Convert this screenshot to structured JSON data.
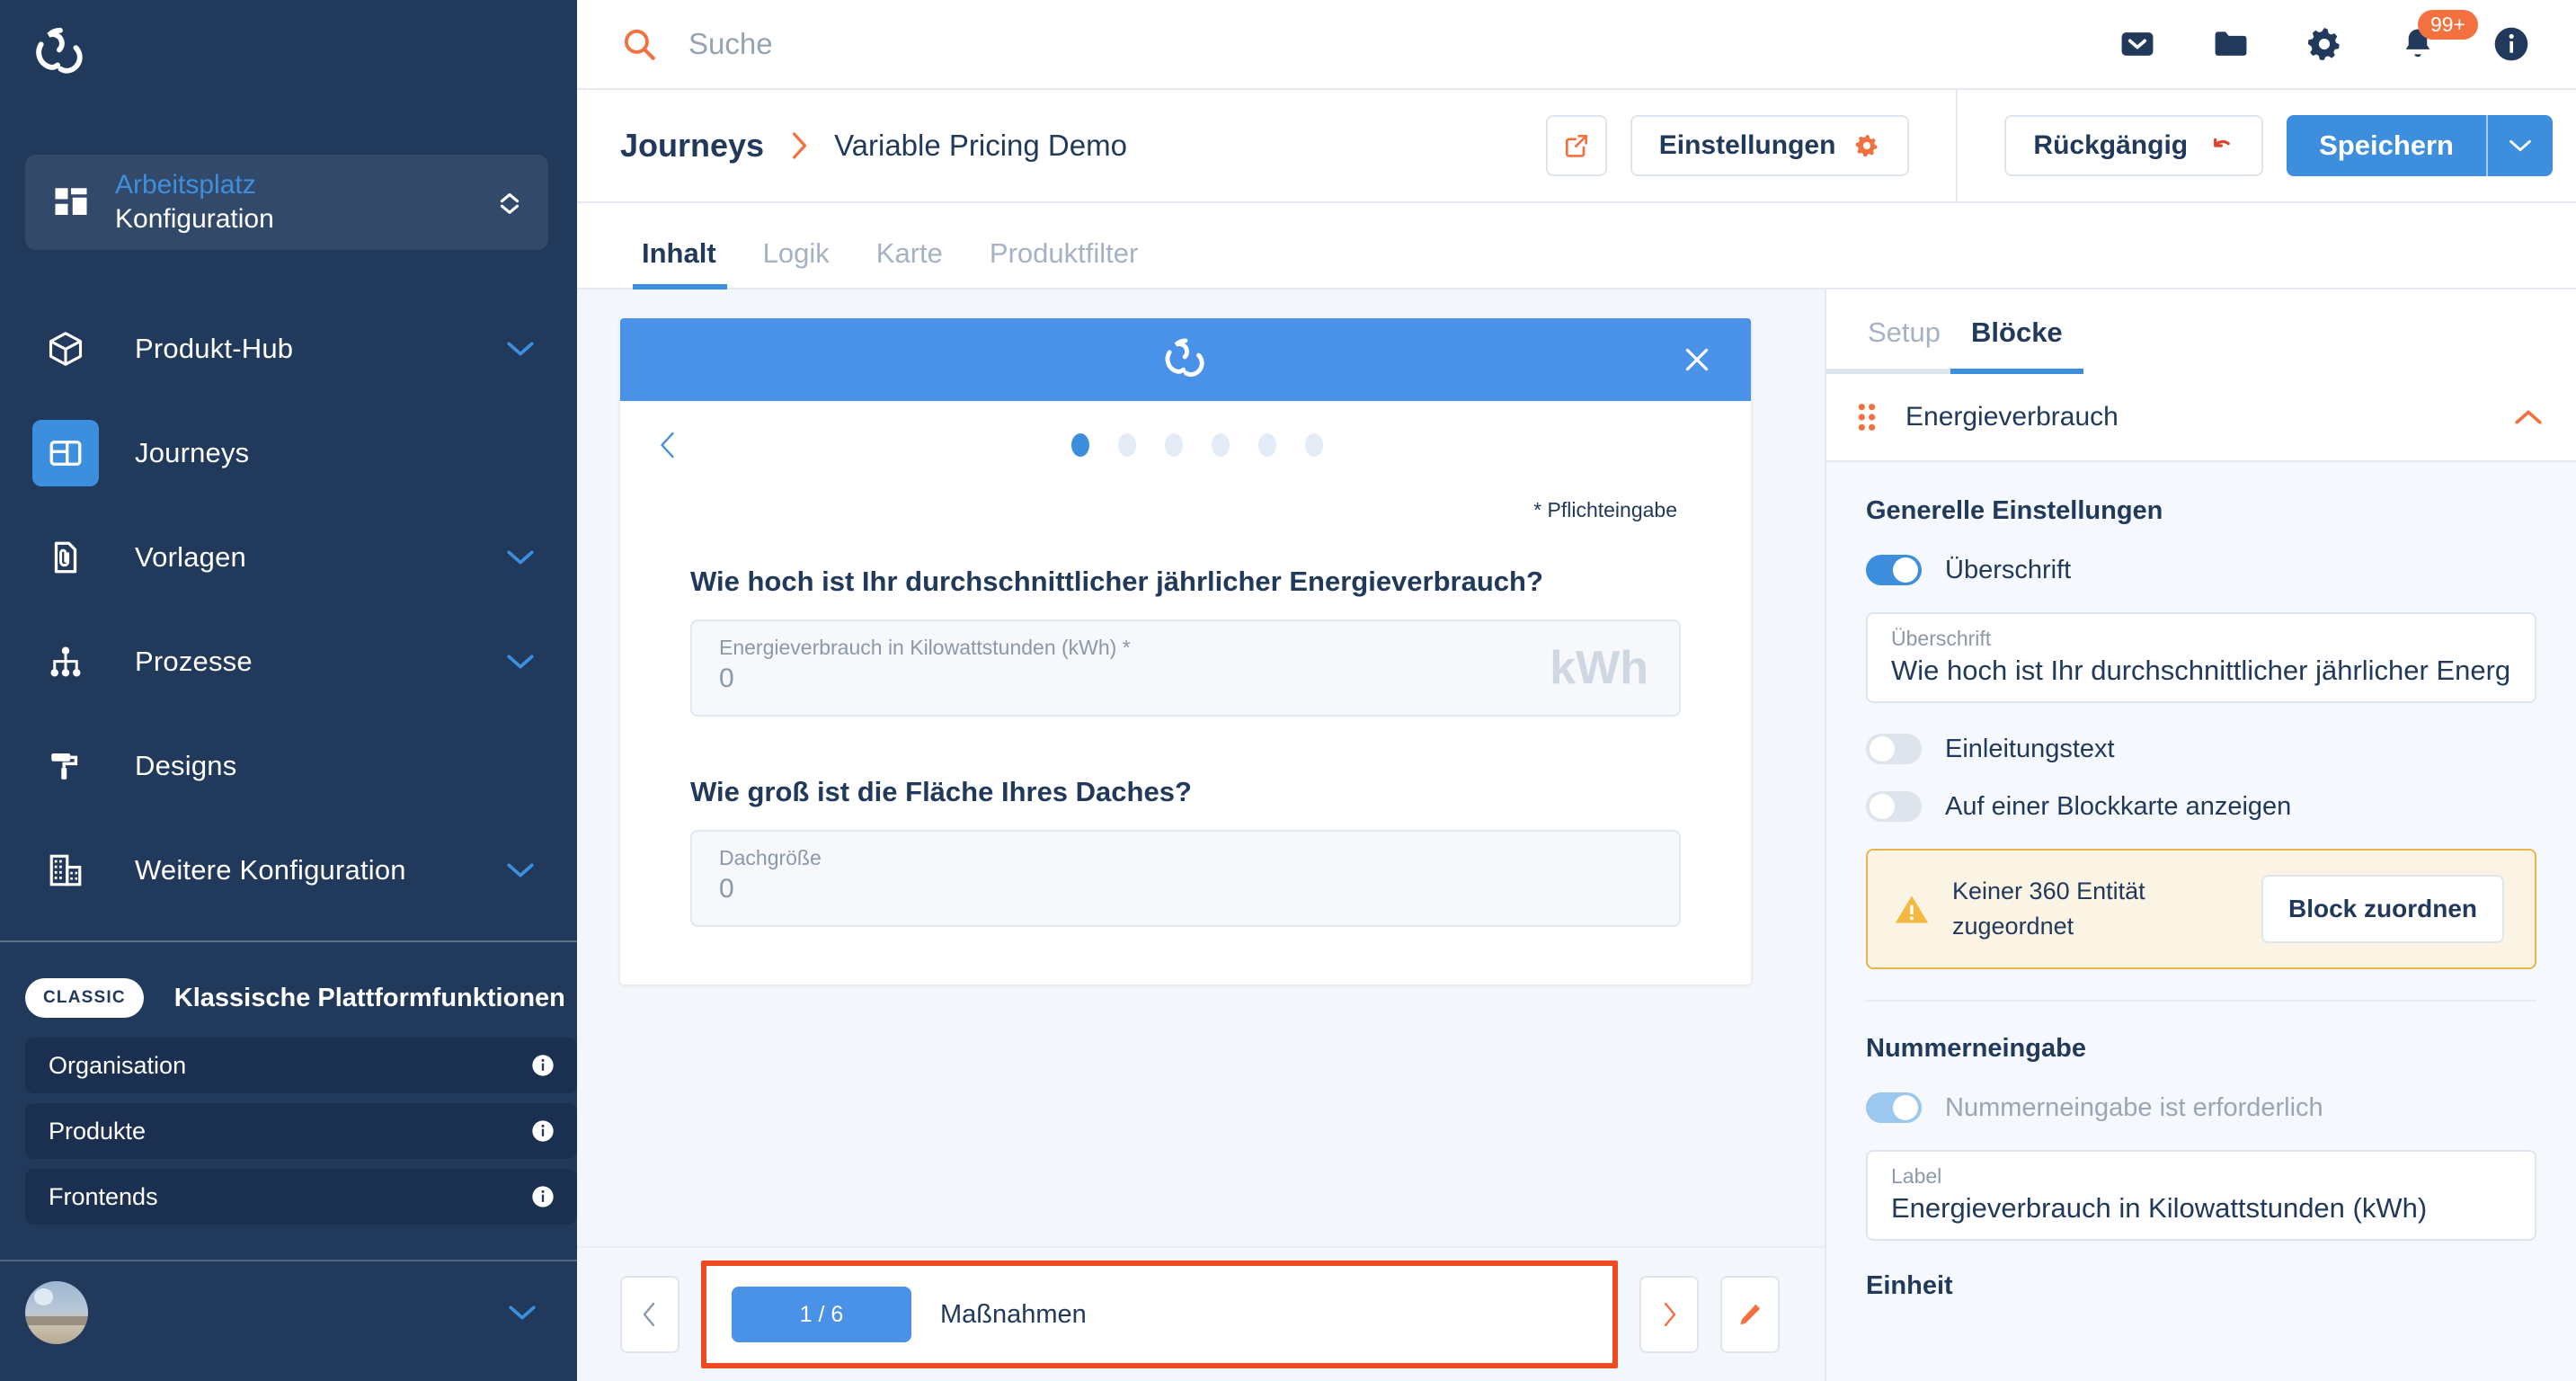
{
  "sidebar": {
    "logo_icon": "refresh-circle-logo",
    "workspace": {
      "top": "Arbeitsplatz",
      "bottom": "Konfiguration",
      "chevron_icon": "chevron-up-down-icon"
    },
    "nav": [
      {
        "label": "Produkt-Hub",
        "icon": "cube-icon",
        "chevron": "chevron-down-icon",
        "active": false
      },
      {
        "label": "Journeys",
        "icon": "layout-icon",
        "chevron": "",
        "active": true
      },
      {
        "label": "Vorlagen",
        "icon": "document-clip-icon",
        "chevron": "chevron-down-icon",
        "active": false
      },
      {
        "label": "Prozesse",
        "icon": "hierarchy-icon",
        "chevron": "chevron-down-icon",
        "active": false
      },
      {
        "label": "Designs",
        "icon": "paint-roller-icon",
        "chevron": "",
        "active": false
      },
      {
        "label": "Weitere Konfiguration",
        "icon": "building-icon",
        "chevron": "chevron-down-icon",
        "active": false
      }
    ],
    "classic": {
      "badge": "CLASSIC",
      "title": "Klassische Plattformfunktionen",
      "items": [
        {
          "label": "Organisation",
          "icon": "info-icon"
        },
        {
          "label": "Produkte",
          "icon": "info-icon"
        },
        {
          "label": "Frontends",
          "icon": "info-icon"
        }
      ]
    },
    "user": {
      "avatar_icon": "user-avatar",
      "chevron": "chevron-down-icon"
    }
  },
  "topbar": {
    "search": {
      "placeholder": "Suche",
      "value": "",
      "icon": "search-icon"
    },
    "icons": [
      {
        "name": "mail-icon"
      },
      {
        "name": "folder-icon"
      },
      {
        "name": "gear-icon"
      },
      {
        "name": "bell-icon",
        "badge": "99+"
      },
      {
        "name": "info-icon"
      }
    ]
  },
  "header": {
    "breadcrumb_root": "Journeys",
    "breadcrumb_separator_icon": "chevron-right-icon",
    "breadcrumb_leaf": "Variable Pricing Demo",
    "open_external_icon": "external-link-icon",
    "settings_label": "Einstellungen",
    "settings_icon": "gear-icon",
    "undo_label": "Rückgängig",
    "undo_icon": "undo-arrow-icon",
    "save_label": "Speichern",
    "save_caret_icon": "chevron-down-icon"
  },
  "tabs": [
    {
      "label": "Inhalt",
      "active": true
    },
    {
      "label": "Logik",
      "active": false
    },
    {
      "label": "Karte",
      "active": false
    },
    {
      "label": "Produktfilter",
      "active": false
    }
  ],
  "preview": {
    "logo_icon": "refresh-circle-logo",
    "close_icon": "close-icon",
    "prev_icon": "chevron-left-icon",
    "steps_total": 6,
    "step_current": 1,
    "required_note": "* Pflichteingabe",
    "questions": [
      {
        "title": "Wie hoch ist Ihr durchschnittlicher jährlicher Energieverbrauch?",
        "field_label": "Energieverbrauch in Kilowattstunden (kWh) *",
        "field_value": "0",
        "unit": "kWh"
      },
      {
        "title": "Wie groß ist die Fläche Ihres Daches?",
        "field_label": "Dachgröße",
        "field_value": "0",
        "unit": ""
      }
    ]
  },
  "bottombar": {
    "prev_icon": "chevron-left-icon",
    "page_counter": "1 / 6",
    "page_name": "Maßnahmen",
    "next_icon": "chevron-right-icon",
    "edit_icon": "pencil-icon",
    "highlight_color": "#ef4b23"
  },
  "rightpanel": {
    "tabs": [
      {
        "label": "Setup",
        "active": false
      },
      {
        "label": "Blöcke",
        "active": true
      }
    ],
    "block": {
      "drag_icon": "drag-dots-icon",
      "title": "Energieverbrauch",
      "collapse_icon": "chevron-up-icon"
    },
    "general_section_title": "Generelle Einstellungen",
    "toggles": [
      {
        "label": "Überschrift",
        "state": "on"
      },
      {
        "label": "Einleitungstext",
        "state": "off"
      },
      {
        "label": "Auf einer Blockkarte anzeigen",
        "state": "off"
      }
    ],
    "heading_field": {
      "label": "Überschrift",
      "value": "Wie hoch ist Ihr durchschnittlicher jährlicher Energie"
    },
    "warning": {
      "icon": "warning-triangle-icon",
      "text": "Keiner 360 Entität zugeordnet",
      "button": "Block zuordnen"
    },
    "number_section_title": "Nummerneingabe",
    "number_required_toggle": {
      "label": "Nummerneingabe ist erforderlich",
      "state": "on-muted"
    },
    "label_field": {
      "label": "Label",
      "value": "Energieverbrauch in Kilowattstunden (kWh)"
    },
    "unit_section_title": "Einheit"
  },
  "colors": {
    "sidebar_bg": "#21395b",
    "accent_blue": "#3d8fdd",
    "accent_orange": "#f2713f",
    "highlight_red": "#ef4b23",
    "warning_yellow": "#e9b44c"
  }
}
